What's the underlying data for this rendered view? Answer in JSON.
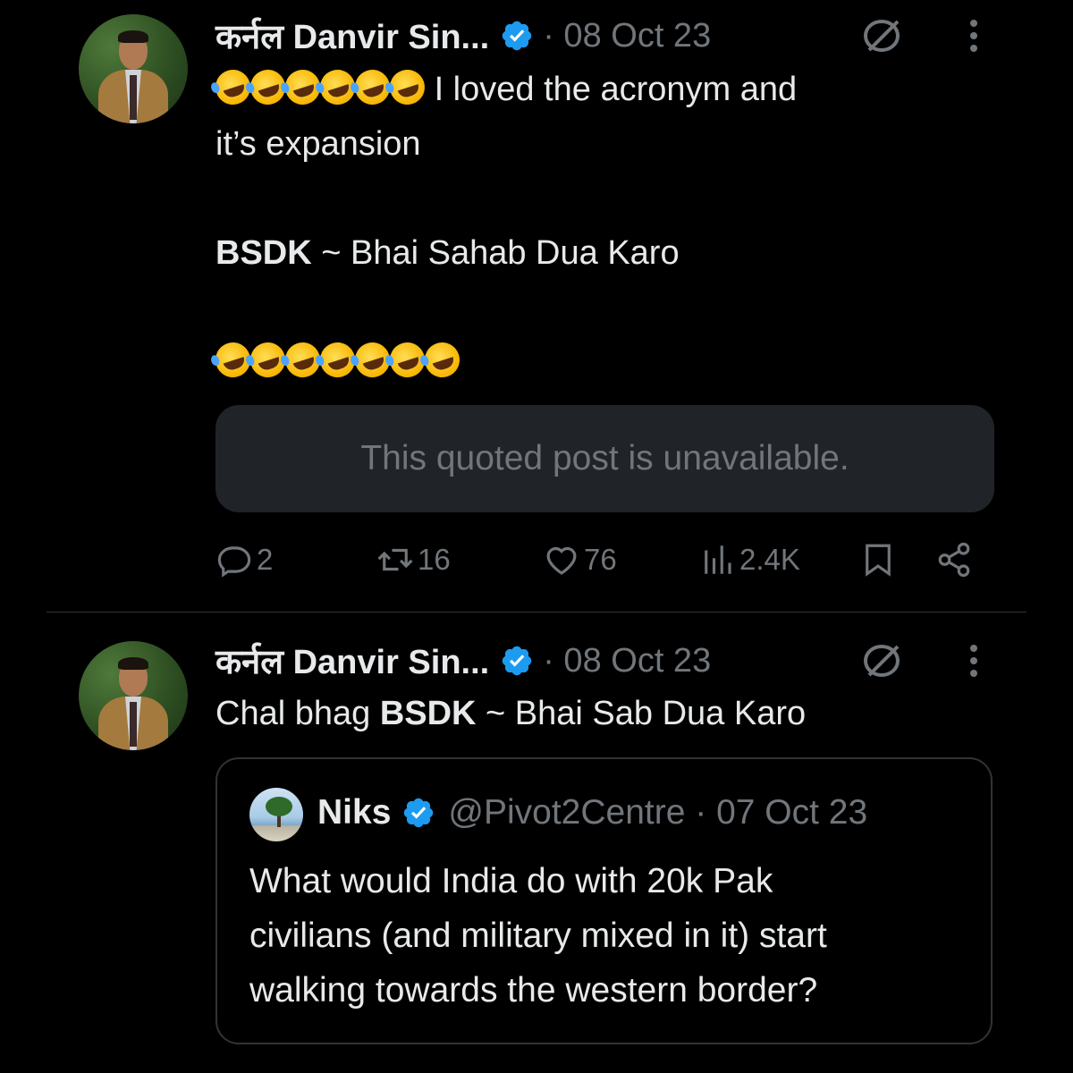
{
  "tweets": [
    {
      "author": {
        "name": "कर्नल Danvir Sin...",
        "verified": true,
        "date": "· 08 Oct 23"
      },
      "text": {
        "line1": "I loved the acronym and",
        "line2": "it’s expansion",
        "bold": "BSDK",
        "line3_rest": " ~ Bhai Sahab Dua Karo"
      },
      "emoji": {
        "name": "rolling-on-the-floor-laughing",
        "count_line1": 6,
        "count_line4": 7
      },
      "quote_unavailable": "This quoted post is unavailable.",
      "actions": {
        "replies": "2",
        "reposts": "16",
        "likes": "76",
        "views": "2.4K"
      }
    },
    {
      "author": {
        "name": "कर्नल Danvir Sin...",
        "verified": true,
        "date": "· 08 Oct 23"
      },
      "text": {
        "prefix": "Chal bhag ",
        "bold": "BSDK",
        "rest": " ~ Bhai Sab Dua Karo"
      },
      "quoted": {
        "name": "Niks",
        "verified": true,
        "handle_date": "@Pivot2Centre · 07 Oct 23",
        "lines": [
          "What would India do with 20k Pak",
          "civilians (and military mixed in it) start",
          "walking towards the western border?"
        ]
      }
    }
  ],
  "colors": {
    "background": "#000000",
    "text": "#e7e9ea",
    "muted": "#71767b",
    "verified": "#1d9bf0",
    "card": "#202327"
  }
}
